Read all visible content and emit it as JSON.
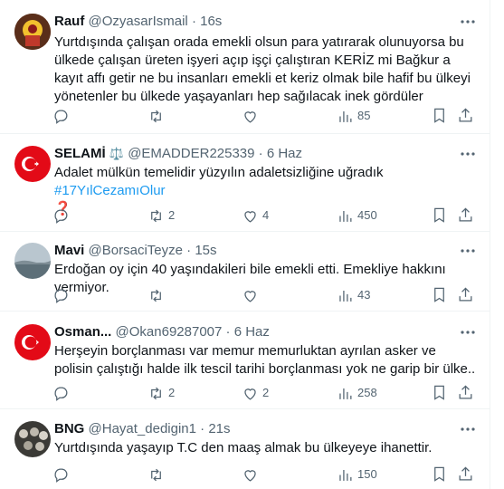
{
  "tweets": [
    {
      "name": "Rauf",
      "handle": "@OzyasarIsmail",
      "dot": "·",
      "time": "16s",
      "text": "Yurtdışında çalışan orada emekli olsun para yatırarak olunuyorsa bu ülkede çalışan üreten işyeri açıp işçi çalıştıran KERİZ  mi Bağkur a kayıt affı getir ne bu insanları emekli et keriz olmak bile hafif bu ülkeyi yönetenler bu ülkede yaşayanları hep sağılacak inek gördüler",
      "replies": "",
      "retweets": "",
      "likes": "",
      "views": "85"
    },
    {
      "name": "SELAMİ",
      "badge": "⚖️",
      "handle": "@EMADDER225339",
      "dot": "·",
      "time": "6 Haz",
      "text": "Adalet mülkün temelidir yüzyılın adaletsizliğine uğradık ",
      "hashtag": "#17YılCezamıOlur",
      "emoji": "❓",
      "replies": "",
      "retweets": "2",
      "likes": "4",
      "views": "450"
    },
    {
      "name": "Mavi",
      "handle": "@BorsaciTeyze",
      "dot": "·",
      "time": "15s",
      "text": "Erdoğan oy için 40 yaşındakileri bile emekli etti. Emekliye hakkını vermiyor.",
      "replies": "",
      "retweets": "",
      "likes": "",
      "views": "43"
    },
    {
      "name": "Osman...",
      "handle": "@Okan69287007",
      "dot": "·",
      "time": "6 Haz",
      "text": "Herşeyin borçlanması var memur memurluktan ayrılan asker ve polisin çalıştığı halde ilk tescil tarihi borçlanması yok ne garip bir ülke..",
      "replies": "",
      "retweets": "2",
      "likes": "2",
      "views": "258"
    },
    {
      "name": "BNG",
      "handle": "@Hayat_dedigin1",
      "dot": "·",
      "time": "21s",
      "text": "Yurtdışında yaşayıp T.C den maaş almak bu ülkeyeye ihanettir.",
      "replies": "",
      "retweets": "",
      "likes": "",
      "views": "150"
    }
  ],
  "colors": {
    "text": "#0f1419",
    "secondary": "#536471",
    "link": "#1d9bf0",
    "border": "#eff3f4"
  }
}
